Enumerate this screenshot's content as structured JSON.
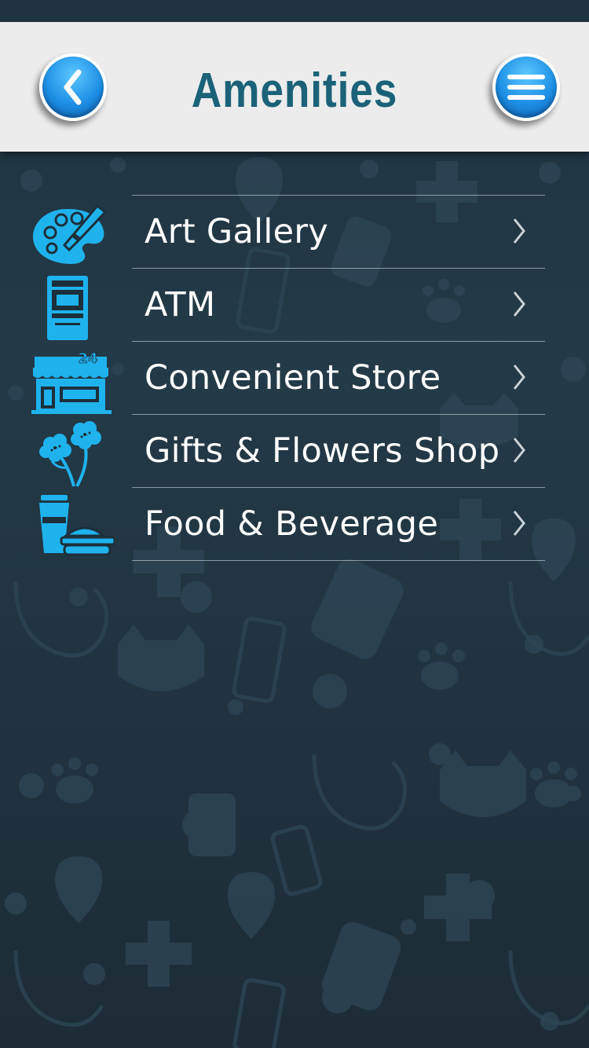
{
  "header": {
    "title": "Amenities",
    "back_icon": "chevron-left-icon",
    "menu_icon": "hamburger-menu-icon"
  },
  "theme": {
    "header_bg": "#ececec",
    "title_color": "#1b6278",
    "button_blue": "#1d8fe5",
    "icon_color": "#1fb3ee",
    "background": "#233a48"
  },
  "amenities": {
    "items": [
      {
        "label": "Art Gallery",
        "icon": "palette-icon"
      },
      {
        "label": "ATM",
        "icon": "atm-machine-icon"
      },
      {
        "label": "Convenient Store",
        "icon": "store-24-icon"
      },
      {
        "label": "Gifts & Flowers Shop",
        "icon": "flowers-icon"
      },
      {
        "label": "Food & Beverage",
        "icon": "cup-burger-icon"
      }
    ]
  },
  "store_icon_text": "24"
}
